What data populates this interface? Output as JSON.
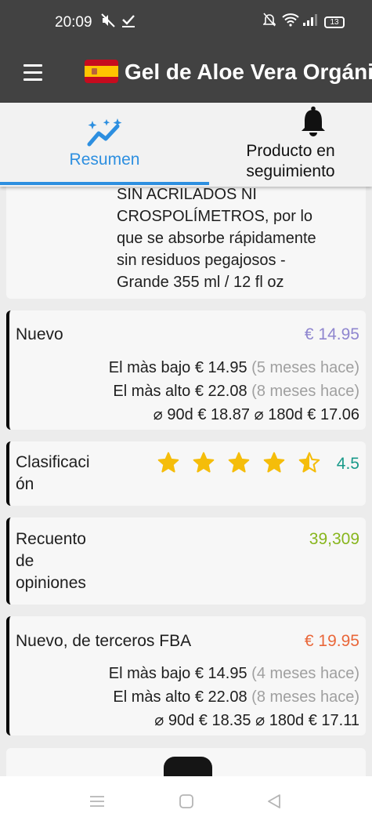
{
  "status_bar": {
    "time": "20:09",
    "battery": "13",
    "icons": [
      "mute-icon",
      "check-icon",
      "do-not-disturb-icon",
      "wifi-icon",
      "signal-icon",
      "battery-icon"
    ]
  },
  "app_bar": {
    "menu_icon": "hamburger-menu-icon",
    "flag": "spain-flag",
    "title": "Gel de Aloe Vera Orgánico"
  },
  "tabs": [
    {
      "label": "Resumen",
      "icon": "chart-sparkle-icon",
      "selected": true
    },
    {
      "label": "Producto en seguimiento",
      "icon": "bell-icon",
      "selected": false
    }
  ],
  "description": {
    "line0": "SIN ACRILADOS NI",
    "line1": "CROSPOLÍMETROS, por lo",
    "line2": "que se absorbe rápidamente",
    "line3": "sin residuos pegajosos -",
    "line4": "Grande 355 ml / 12 fl oz"
  },
  "new_price": {
    "label": "Nuevo",
    "value": "€ 14.95",
    "lowest_label": "El màs bajo",
    "lowest_value": "€ 14.95",
    "lowest_when": "(5 meses hace)",
    "highest_label": "El màs alto",
    "highest_value": "€ 22.08",
    "highest_when": "(8 meses hace)",
    "avg90_label": "⌀ 90d",
    "avg90_value": "€ 18.87",
    "avg180_label": "⌀ 180d",
    "avg180_value": "€ 17.06",
    "color": "#8f86cf"
  },
  "rating": {
    "label_line1": "Clasificaci",
    "label_line2": "ón",
    "value": "4.5",
    "stars": 4.5,
    "star_color": "#f5bd0a",
    "color": "#1a9a8a"
  },
  "reviews": {
    "label_line1": "Recuento",
    "label_line2": "de",
    "label_line3": "opiniones",
    "value": "39,309",
    "color": "#88b61e"
  },
  "fba_price": {
    "label": "Nuevo, de terceros FBA",
    "value": "€ 19.95",
    "lowest_label": "El màs bajo",
    "lowest_value": "€ 14.95",
    "lowest_when": "(4 meses hace)",
    "highest_label": "El màs alto",
    "highest_value": "€ 22.08",
    "highest_when": "(8 meses hace)",
    "avg90_label": "⌀ 90d",
    "avg90_value": "€ 18.35",
    "avg180_label": "⌀ 180d",
    "avg180_value": "€ 17.11",
    "color": "#e9673a"
  },
  "nav_bar": {
    "buttons": [
      "recents-icon",
      "home-icon",
      "back-icon"
    ]
  }
}
